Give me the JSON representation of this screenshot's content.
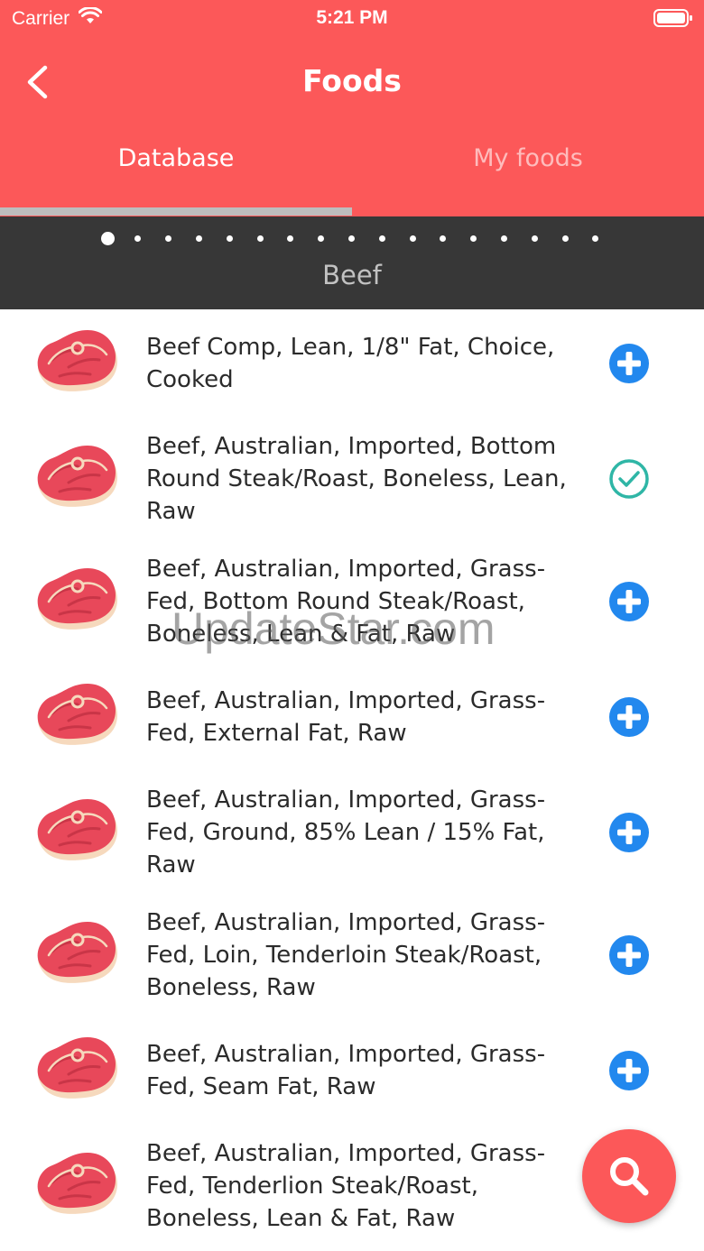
{
  "status_bar": {
    "carrier": "Carrier",
    "time": "5:21 PM",
    "icons": [
      "wifi-icon",
      "battery-icon"
    ]
  },
  "nav": {
    "title": "Foods",
    "back_icon": "back-chevron-icon"
  },
  "tabs": [
    {
      "label": "Database",
      "active": true
    },
    {
      "label": "My foods",
      "active": false
    }
  ],
  "category": {
    "label": "Beef",
    "page_count": 17,
    "active_page": 0
  },
  "foods": [
    {
      "name": "Beef Comp, Lean, 1/8\" Fat, Choice, Cooked",
      "action": "add-icon"
    },
    {
      "name": "Beef, Australian, Imported, Bottom Round Steak/Roast, Boneless, Lean, Raw",
      "action": "check-icon"
    },
    {
      "name": "Beef, Australian, Imported, Grass-Fed, Bottom Round Steak/Roast, Boneless, Lean & Fat, Raw",
      "action": "add-icon"
    },
    {
      "name": "Beef, Australian, Imported, Grass-Fed, External Fat, Raw",
      "action": "add-icon"
    },
    {
      "name": "Beef, Australian, Imported, Grass-Fed, Ground, 85% Lean / 15% Fat, Raw",
      "action": "add-icon"
    },
    {
      "name": "Beef, Australian, Imported, Grass-Fed, Loin, Tenderloin Steak/Roast, Boneless, Raw",
      "action": "add-icon"
    },
    {
      "name": "Beef, Australian, Imported, Grass-Fed, Seam Fat, Raw",
      "action": "add-icon"
    },
    {
      "name": "Beef, Australian, Imported, Grass-Fed, Tenderlion Steak/Roast, Boneless, Lean & Fat, Raw",
      "action": "none"
    }
  ],
  "watermark": "UpdateStar.com",
  "fab": {
    "icon": "search-icon"
  },
  "colors": {
    "header": "#fc5859",
    "category_bar": "#373737",
    "add": "#2288ee",
    "check": "#2fb6a6"
  }
}
